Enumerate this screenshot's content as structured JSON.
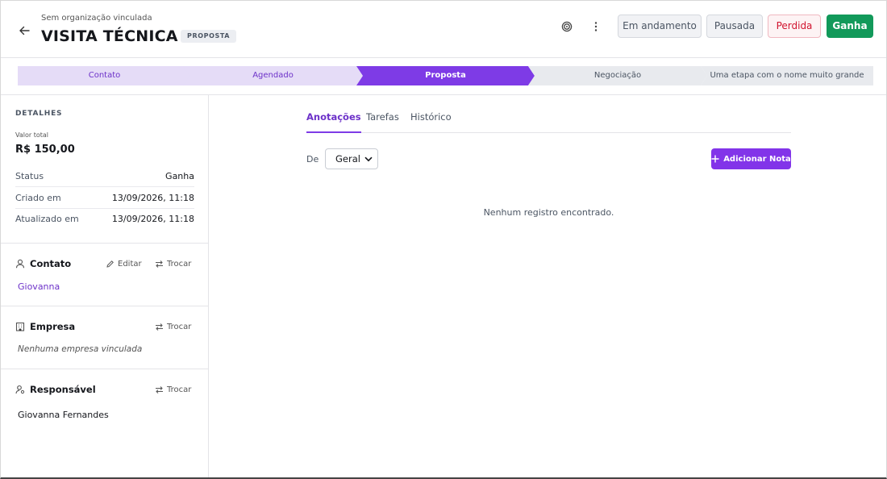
{
  "header": {
    "organization": "Sem organização vinculada",
    "title": "VISITA TÉCNICA",
    "stage_badge": "PROPOSTA",
    "icons": {
      "back": "arrow-left-icon",
      "target": "target-icon",
      "more": "more-vertical-icon"
    },
    "buttons": {
      "in_progress": "Em andamento",
      "paused": "Pausada",
      "lost": "Perdida",
      "won": "Ganha"
    }
  },
  "pipeline": {
    "steps": [
      {
        "label": "Contato",
        "state": "done"
      },
      {
        "label": "Agendado",
        "state": "done"
      },
      {
        "label": "Proposta",
        "state": "current"
      },
      {
        "label": "Negociação",
        "state": "pending"
      },
      {
        "label": "Uma etapa com o nome muito grande",
        "state": "pending"
      }
    ]
  },
  "details": {
    "heading": "DETALHES",
    "total_label": "Valor total",
    "total_value": "R$ 150,00",
    "rows": [
      {
        "label": "Status",
        "value": "Ganha"
      },
      {
        "label": "Criado em",
        "value": "13/09/2026, 11:18"
      },
      {
        "label": "Atualizado em",
        "value": "13/09/2026, 11:18"
      }
    ]
  },
  "contact": {
    "title": "Contato",
    "edit_label": "Editar",
    "swap_label": "Trocar",
    "name": "Giovanna"
  },
  "company": {
    "title": "Empresa",
    "swap_label": "Trocar",
    "empty": "Nenhuma empresa vinculada"
  },
  "owner": {
    "title": "Responsável",
    "swap_label": "Trocar",
    "name": "Giovanna Fernandes"
  },
  "main": {
    "tabs": [
      {
        "label": "Anotações",
        "active": true
      },
      {
        "label": "Tarefas",
        "active": false
      },
      {
        "label": "Histórico",
        "active": false
      }
    ],
    "filter_label": "De",
    "filter_value": "Geral",
    "add_note_label": "Adicionar Nota",
    "empty_state": "Nenhum registro encontrado."
  },
  "colors": {
    "accent": "#7e3be6",
    "step_done": "#e5dcf7",
    "step_pending": "#e8eaee",
    "won": "#12995a",
    "lost": "#d1142f"
  }
}
